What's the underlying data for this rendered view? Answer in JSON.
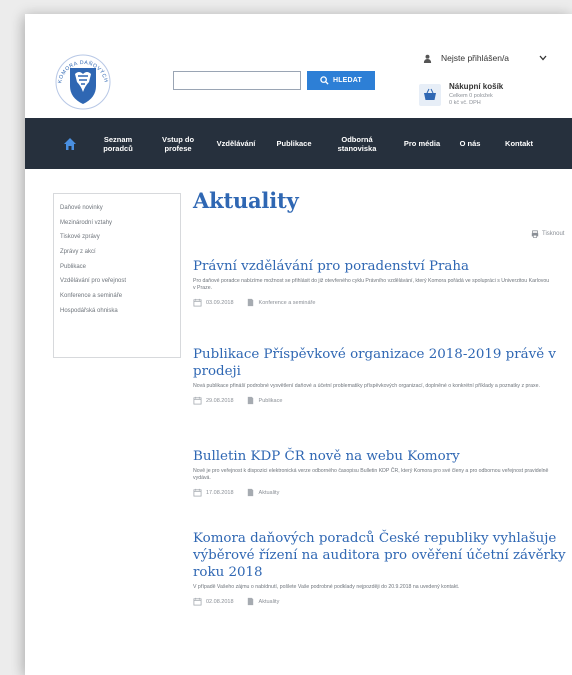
{
  "header": {
    "logo_text": "KOMORA DAŇOVÝCH PORADCŮ",
    "search": {
      "value": "",
      "button_label": "HLEDAT"
    },
    "login": {
      "label": "Nejste přihlášen/a"
    },
    "cart": {
      "title": "Nákupní košík",
      "subtitle_line1": "Celkem 0 položek",
      "subtitle_line2": "0 kč vč. DPH"
    }
  },
  "nav": {
    "items": [
      {
        "label": "Seznam\nporadců"
      },
      {
        "label": "Vstup do\nprofese"
      },
      {
        "label": "Vzdělávání"
      },
      {
        "label": "Publikace"
      },
      {
        "label": "Odborná\nstanoviska"
      },
      {
        "label": "Pro média"
      },
      {
        "label": "O nás"
      },
      {
        "label": "Kontakt"
      }
    ]
  },
  "sidebar": {
    "items": [
      {
        "label": "Daňové novinky"
      },
      {
        "label": "Mezinárodní vztahy"
      },
      {
        "label": "Tiskové zprávy"
      },
      {
        "label": "Zprávy z akcí"
      },
      {
        "label": "Publikace"
      },
      {
        "label": "Vzdělávání pro veřejnost"
      },
      {
        "label": "Konference a semináře"
      },
      {
        "label": "Hospodářská ohniska"
      }
    ]
  },
  "main": {
    "heading": "Aktuality",
    "print_label": "Tisknout",
    "articles": [
      {
        "title": "Právní vzdělávání pro poradenství Praha",
        "excerpt": "Pro daňové poradce nabízíme možnost se přihlásit do již otevřeného cyklu Právního vzdělávání, který Komora pořádá ve spolupráci s Univerzitou Karlovou v Praze.",
        "date": "03.09.2018",
        "category": "Konference a semináře"
      },
      {
        "title": "Publikace Příspěvkové organizace 2018-2019 právě v prodeji",
        "excerpt": "Nová publikace přináší podrobné vysvětlení daňové a účetní problematiky příspěvkových organizací, doplněné o konkrétní příklady a poznatky z praxe.",
        "date": "29.08.2018",
        "category": "Publikace"
      },
      {
        "title": "Bulletin KDP ČR nově na webu Komory",
        "excerpt": "Nově je pro veřejnost k dispozici elektronická verze odborného časopisu Bulletin KDP ČR, který Komora pro své členy a pro odbornou veřejnost pravidelně vydává.",
        "date": "17.08.2018",
        "category": "Aktuality"
      },
      {
        "title": "Komora daňových poradců České republiky vyhlašuje výběrové řízení na auditora pro ověření účetní závěrky roku 2018",
        "excerpt": "V případě Vašeho zájmu o nabídnutí, pošlete Vaše podrobné podklady nejpozději do 20.9.2018 na uvedený kontakt.",
        "date": "02.08.2018",
        "category": "Aktuality"
      }
    ]
  },
  "colors": {
    "accent": "#2f67b3",
    "nav_bg": "#26303d",
    "button_bg": "#2d7fd6"
  }
}
